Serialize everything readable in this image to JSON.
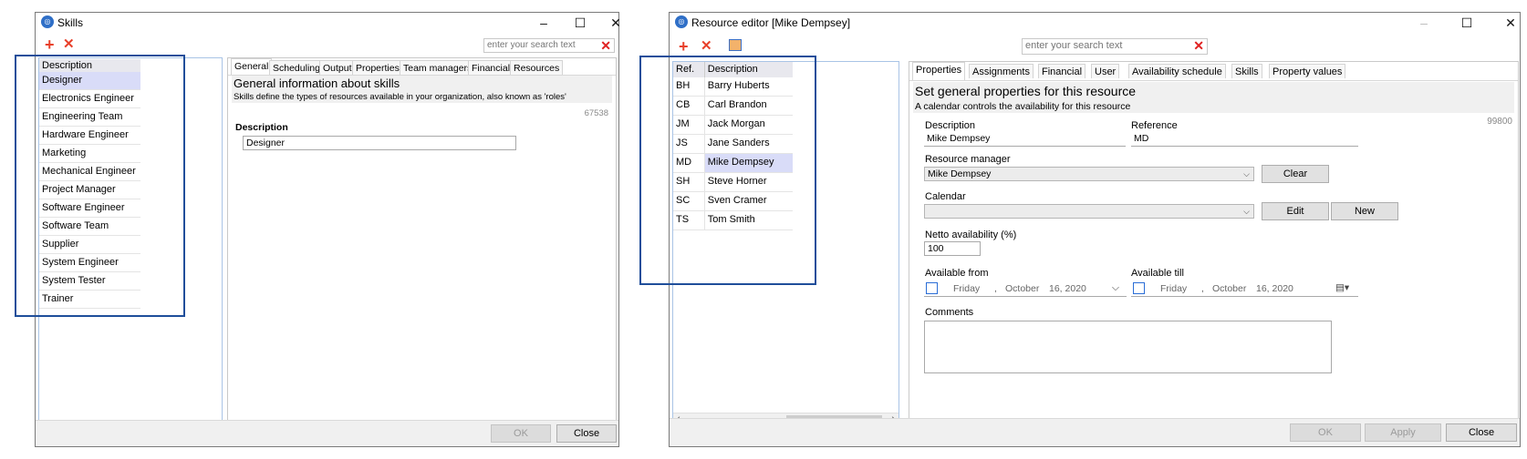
{
  "skills": {
    "title": "Skills",
    "search_placeholder": "enter your search text",
    "list_header": "Description",
    "items": [
      "Designer",
      "Electronics Engineer",
      "Engineering Team",
      "Hardware Engineer",
      "Marketing",
      "Mechanical Engineer",
      "Project Manager",
      "Software Engineer",
      "Software Team",
      "Supplier",
      "System Engineer",
      "System Tester",
      "Trainer"
    ],
    "tabs": [
      "General",
      "Scheduling",
      "Output",
      "Properties",
      "Team managers",
      "Financial",
      "Resources"
    ],
    "info_title": "General information about skills",
    "info_subtitle": "Skills define the types of resources available in your organization, also known as 'roles'",
    "record_id": "67538",
    "description_label": "Description",
    "description_value": "Designer",
    "ok_label": "OK",
    "close_label": "Close"
  },
  "resource": {
    "title": "Resource editor [Mike Dempsey]",
    "search_placeholder": "enter your search text",
    "col_ref": "Ref.",
    "col_desc": "Description",
    "rows": [
      {
        "ref": "BH",
        "desc": "Barry Huberts"
      },
      {
        "ref": "CB",
        "desc": "Carl Brandon"
      },
      {
        "ref": "JM",
        "desc": "Jack Morgan"
      },
      {
        "ref": "JS",
        "desc": "Jane Sanders"
      },
      {
        "ref": "MD",
        "desc": "Mike Dempsey"
      },
      {
        "ref": "SH",
        "desc": "Steve Horner"
      },
      {
        "ref": "SC",
        "desc": "Sven Cramer"
      },
      {
        "ref": "TS",
        "desc": "Tom Smith"
      }
    ],
    "tabs": [
      "Properties",
      "Assignments",
      "Financial",
      "User",
      "Availability schedule",
      "Skills",
      "Property values"
    ],
    "info_title": "Set general properties for this resource",
    "info_subtitle": "A calendar controls the availability for this resource",
    "record_id": "99800",
    "description_label": "Description",
    "description_value": "Mike Dempsey",
    "reference_label": "Reference",
    "reference_value": "MD",
    "manager_label": "Resource manager",
    "manager_value": "Mike Dempsey",
    "clear_label": "Clear",
    "calendar_label": "Calendar",
    "calendar_value": "",
    "edit_label": "Edit",
    "new_label": "New",
    "netto_label": "Netto availability (%)",
    "netto_value": "100",
    "from_label": "Available from",
    "from_day": "Friday",
    "from_month": "October",
    "from_date": "16, 2020",
    "till_label": "Available till",
    "till_day": "Friday",
    "till_month": "October",
    "till_date": "16, 2020",
    "comments_label": "Comments",
    "ok_label": "OK",
    "apply_label": "Apply",
    "close_label": "Close"
  }
}
